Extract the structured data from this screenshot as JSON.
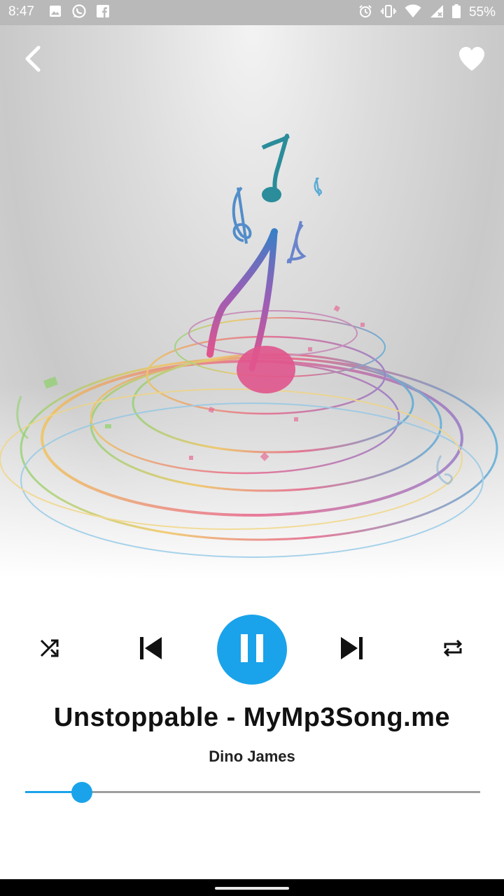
{
  "status_bar": {
    "time": "8:47",
    "battery": "55%",
    "icons": [
      "image-icon",
      "whatsapp-icon",
      "facebook-icon",
      "alarm-icon",
      "vibrate-icon",
      "wifi-icon",
      "signal-icon",
      "battery-icon"
    ]
  },
  "header": {
    "back_icon": "chevron-left-icon",
    "favorite_icon": "heart-icon"
  },
  "player": {
    "title": "Unstoppable - MyMp3Song.me",
    "artist": "Dino James",
    "state": "playing",
    "progress_fraction": 0.125,
    "controls": [
      "shuffle-icon",
      "skip-previous-icon",
      "pause-icon",
      "skip-next-icon",
      "repeat-icon"
    ]
  },
  "colors": {
    "accent": "#1aa3ea",
    "status_bar": "#b9b9b9",
    "track": "#9e9e9e"
  }
}
